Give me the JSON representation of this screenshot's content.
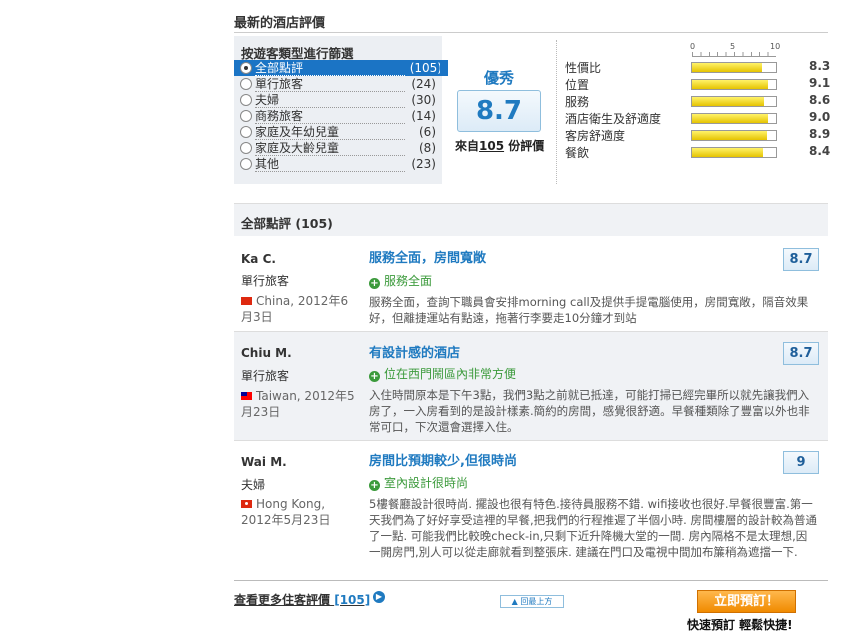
{
  "section_title": "最新的酒店評價",
  "filter": {
    "title": "按遊客類型進行篩選",
    "items": [
      {
        "label": "全部點評",
        "count": "(105)"
      },
      {
        "label": "單行旅客",
        "count": "(24)"
      },
      {
        "label": "夫婦",
        "count": "(30)"
      },
      {
        "label": "商務旅客",
        "count": "(14)"
      },
      {
        "label": "家庭及年幼兒童",
        "count": "(6)"
      },
      {
        "label": "家庭及大齡兒童",
        "count": "(8)"
      },
      {
        "label": "其他",
        "count": "(23)"
      }
    ]
  },
  "overall": {
    "grade": "優秀",
    "score": "8.7",
    "from_prefix": "來自",
    "review_count": "105",
    "from_suffix": " 份評價"
  },
  "scale": {
    "min": "0",
    "mid": "5",
    "max": "10"
  },
  "ratings": [
    {
      "label": "性價比",
      "value": "8.3",
      "score": 8.3
    },
    {
      "label": "位置",
      "value": "9.1",
      "score": 9.1
    },
    {
      "label": "服務",
      "value": "8.6",
      "score": 8.6
    },
    {
      "label": "酒店衛生及舒適度",
      "value": "9.0",
      "score": 9.0
    },
    {
      "label": "客房舒適度",
      "value": "8.9",
      "score": 8.9
    },
    {
      "label": "餐飲",
      "value": "8.4",
      "score": 8.4
    }
  ],
  "all_reviews_header": "全部點評 (105)",
  "reviews": [
    {
      "name": "Ka C.",
      "type": "單行旅客",
      "location": "China, 2012年6月3日",
      "title": "服務全面，房間寬敞",
      "positive": "服務全面",
      "text": "服務全面，查詢下職員會安排morning call及提供手提電腦使用，房間寬敞，隔音效果好，但離捷運站有點遠，拖著行李要走10分鐘才到站",
      "score": "8.7"
    },
    {
      "name": "Chiu M.",
      "type": "單行旅客",
      "location": "Taiwan, 2012年5月23日",
      "title": "有設計感的酒店",
      "positive": "位在西門鬧區內非常方便",
      "text": "入住時間原本是下午3點，我們3點之前就已抵達，可能打掃已經完畢所以就先讓我們入房了，一入房看到的是設計樣素.簡約的房間，感覺很舒適。早餐種類除了豐富以外也非常可口，下次還會選擇入住。",
      "score": "8.7"
    },
    {
      "name": "Wai M.",
      "type": "夫婦",
      "location": "Hong Kong, 2012年5月23日",
      "title": "房間比預期較少,但很時尚",
      "positive": "室內設計很時尚",
      "text": "5樓餐廳設計很時尚. 擺設也很有特色.接待員服務不錯. wifi接收也很好.早餐很豐富.第一天我們為了好好享受這裡的早餐,把我們的行程推遲了半個小時. 房間樓層的設計較為普通了一點. 可能我們比較晚check-in,只剩下近升降機大堂的一間. 房內隔格不是太理想,因一開房門,別人可以從走廊就看到整張床. 建議在門口及電視中間加布簾稍為遮擋一下.",
      "score": "9"
    }
  ],
  "footer": {
    "more_text": "查看更多住客評價",
    "more_count": "[105]",
    "back_top": "▲ 回最上方",
    "book_button": "立即預訂！",
    "book_sub": "快速預訂 輕鬆快捷!"
  },
  "colors": {
    "accent": "#1f7ac0",
    "active": "#1b74c5",
    "positive": "#3b9a3b",
    "bar": "#f2de1d",
    "book": "#f39a10"
  }
}
